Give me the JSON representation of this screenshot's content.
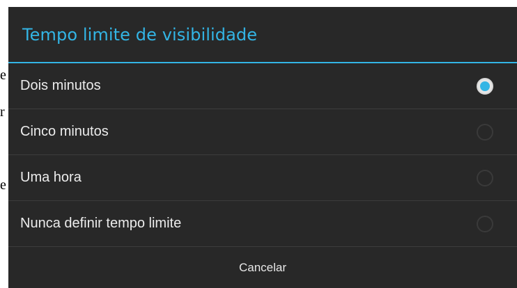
{
  "background": {
    "text_fragments": [
      "e",
      "r",
      "e"
    ]
  },
  "dialog": {
    "title": "Tempo limite de visibilidade",
    "options": [
      {
        "label": "Dois minutos",
        "selected": true
      },
      {
        "label": "Cinco minutos",
        "selected": false
      },
      {
        "label": "Uma hora",
        "selected": false
      },
      {
        "label": "Nunca definir tempo limite",
        "selected": false
      }
    ],
    "cancel_label": "Cancelar"
  },
  "colors": {
    "accent": "#33b5e5",
    "dialog_background": "#282828",
    "text": "#ececec",
    "divider": "#3d3d3d"
  },
  "icons": {
    "selected_radio": "radio-checked-icon",
    "unselected_radio": "radio-unchecked-icon"
  }
}
